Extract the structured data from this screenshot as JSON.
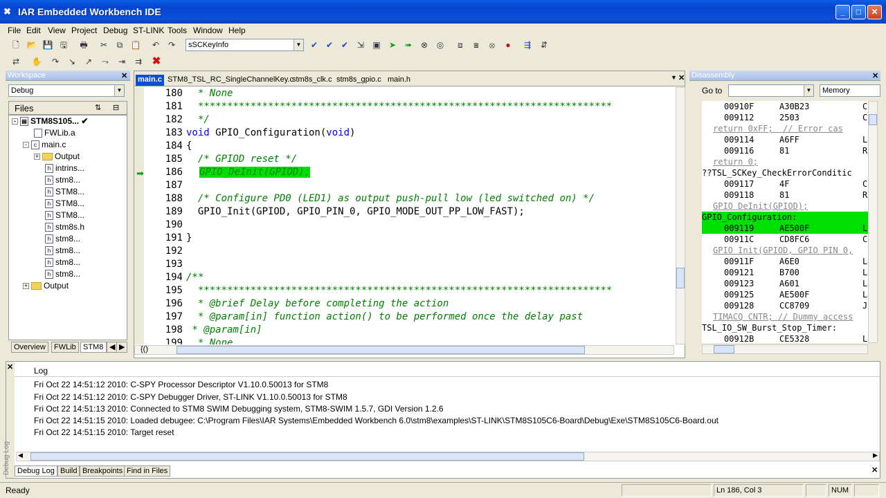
{
  "window": {
    "title": "IAR Embedded Workbench IDE"
  },
  "menu": [
    "File",
    "Edit",
    "View",
    "Project",
    "Debug",
    "ST-LINK",
    "Tools",
    "Window",
    "Help"
  ],
  "toolbar": {
    "combo_value": "sSCKeyInfo"
  },
  "workspace": {
    "title": "Workspace",
    "config": "Debug",
    "files_label": "Files",
    "project": "STM8S105...",
    "project_check": "✔",
    "items": [
      "FWLib.a",
      "main.c",
      "Output",
      "intrins...",
      "stm8...",
      "STM8...",
      "STM8...",
      "STM8...",
      "stm8s.h",
      "stm8...",
      "stm8...",
      "stm8...",
      "stm8...",
      "Output"
    ],
    "tabs": [
      "Overview",
      "FWLib",
      "STM8"
    ]
  },
  "editor": {
    "tabs": [
      "main.c",
      "STM8_TSL_RC_SingleChannelKey.c",
      "stm8s_clk.c",
      "stm8s_gpio.c",
      "main.h"
    ],
    "footer_label": "{()",
    "lines": [
      {
        "n": "180",
        "t": "  * None"
      },
      {
        "n": "181",
        "t": "  ***********************************************************************"
      },
      {
        "n": "182",
        "t": "  */"
      },
      {
        "n": "183",
        "t": "void GPIO_Configuration(void)"
      },
      {
        "n": "184",
        "t": "{"
      },
      {
        "n": "185",
        "t": "  /* GPIOD reset */"
      },
      {
        "n": "186",
        "t": "GPIO_DeInit(GPIOD);"
      },
      {
        "n": "187",
        "t": ""
      },
      {
        "n": "188",
        "t": "  /* Configure PD0 (LED1) as output push-pull low (led switched on) */"
      },
      {
        "n": "189",
        "t": "  GPIO_Init(GPIOD, GPIO_PIN_0, GPIO_MODE_OUT_PP_LOW_FAST);"
      },
      {
        "n": "190",
        "t": ""
      },
      {
        "n": "191",
        "t": "}"
      },
      {
        "n": "192",
        "t": ""
      },
      {
        "n": "193",
        "t": ""
      },
      {
        "n": "194",
        "t": "/**"
      },
      {
        "n": "195",
        "t": "  ***********************************************************************"
      },
      {
        "n": "196",
        "t": "  * @brief Delay before completing the action"
      },
      {
        "n": "197",
        "t": "  * @param[in] function action() to be performed once the delay past"
      },
      {
        "n": "198",
        "t": " * @param[in]"
      },
      {
        "n": "199",
        "t": "  * None"
      }
    ]
  },
  "disassembly": {
    "title": "Disassembly",
    "goto_label": "Go to",
    "memory_label": "Memory",
    "rows": [
      {
        "a": "00910F",
        "b": "A30B23",
        "c": "C"
      },
      {
        "a": "009112",
        "b": "2503",
        "c": "C"
      },
      {
        "src": "return 0xFF;  // Error cas"
      },
      {
        "a": "009114",
        "b": "A6FF",
        "c": "L"
      },
      {
        "a": "009116",
        "b": "81",
        "c": "R"
      },
      {
        "src": "return 0;"
      },
      {
        "label": "??TSL_SCKey_CheckErrorConditic"
      },
      {
        "a": "009117",
        "b": "4F",
        "c": "C"
      },
      {
        "a": "009118",
        "b": "81",
        "c": "R"
      },
      {
        "src": "GPIO DeInit(GPIOD);"
      },
      {
        "label": "GPIO_Configuration:",
        "sel": true
      },
      {
        "a": "009119",
        "b": "AE500F",
        "c": "L",
        "sel": true
      },
      {
        "a": "00911C",
        "b": "CD8FC6",
        "c": "C"
      },
      {
        "src": "GPIO Init(GPIOD, GPIO PIN 0,"
      },
      {
        "a": "00911F",
        "b": "A6E0",
        "c": "L"
      },
      {
        "a": "009121",
        "b": "B700",
        "c": "L"
      },
      {
        "a": "009123",
        "b": "A601",
        "c": "L"
      },
      {
        "a": "009125",
        "b": "AE500F",
        "c": "L"
      },
      {
        "a": "009128",
        "b": "CC8709",
        "c": "J"
      },
      {
        "src": "TIMACQ CNTR; // Dummy access"
      },
      {
        "label": "TSL_IO_SW_Burst_Stop_Timer:"
      },
      {
        "a": "00912B",
        "b": "CE5328",
        "c": "L"
      }
    ]
  },
  "log": {
    "header": "Log",
    "side_label": "Debug Log",
    "lines": [
      "Fri Oct 22 14:51:12 2010: C-SPY Processor Descriptor V1.10.0.50013 for STM8",
      "Fri Oct 22 14:51:12 2010: C-SPY Debugger Driver, ST-LINK V1.10.0.50013 for STM8",
      "Fri Oct 22 14:51:13 2010: Connected to STM8 SWIM Debugging system, STM8-SWIM 1.5.7, GDI Version 1.2.6",
      "Fri Oct 22 14:51:15 2010: Loaded debugee: C:\\Program Files\\IAR Systems\\Embedded Workbench 6.0\\stm8\\examples\\ST-LINK\\STM8S105C6-Board\\Debug\\Exe\\STM8S105C6-Board.out",
      "Fri Oct 22 14:51:15 2010: Target reset"
    ],
    "tabs": [
      "Debug Log",
      "Build",
      "Breakpoints",
      "Find in Files"
    ]
  },
  "status": {
    "ready": "Ready",
    "position": "Ln 186, Col 3",
    "num": "NUM"
  }
}
